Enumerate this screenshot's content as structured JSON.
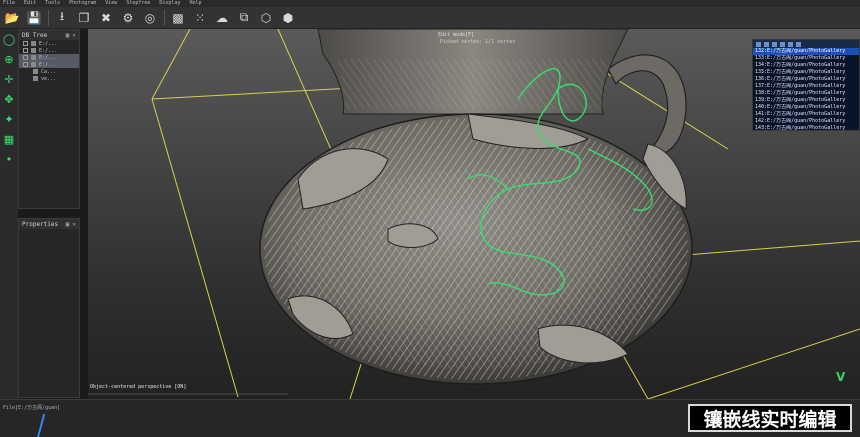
{
  "menu": [
    "File",
    "Edit",
    "Tools",
    "Photogram",
    "View",
    "Stepfree",
    "Display",
    "Help"
  ],
  "toolbar_icons": [
    "folder-open-icon",
    "save-icon",
    "import-icon",
    "clone-icon",
    "delete-icon",
    "settings-icon",
    "globe-icon",
    "mesh-icon",
    "points-icon",
    "cloud-icon",
    "merge-icon",
    "segment-icon",
    "sample-icon"
  ],
  "left_tools": [
    "select-icon",
    "zoom-icon",
    "translate-icon",
    "pivot-icon",
    "lasso-icon",
    "grid-icon",
    "point-icon"
  ],
  "dbtree": {
    "title": "DB Tree",
    "rows": [
      "E:/...",
      "E:/...",
      "E:/...",
      "E:/...",
      "Ca...",
      "ve..."
    ]
  },
  "properties": {
    "title": "Properties"
  },
  "viewport": {
    "overlay_text": "Object-centered perspective [ON]",
    "label_top": "Edit mode[F]",
    "label_top2": "Picked vertex: 1/1 vertex"
  },
  "console": {
    "rows": [
      "132:E:/万古阁/guan/PhotoGallery",
      "133:E:/万古阁/guan/PhotoGallery",
      "134:E:/万古阁/guan/PhotoGallery",
      "135:E:/万古阁/guan/PhotoGallery",
      "136:E:/万古阁/guan/PhotoGallery",
      "137:E:/万古阁/guan/PhotoGallery",
      "138:E:/万古阁/guan/PhotoGallery",
      "139:E:/万古阁/guan/PhotoGallery",
      "140:E:/万古阁/guan/PhotoGallery",
      "141:E:/万古阁/guan/PhotoGallery",
      "142:E:/万古阁/guan/PhotoGallery",
      "143:E:/万古阁/guan/PhotoGallery"
    ],
    "selected_index": 0
  },
  "status": {
    "path": "File[E:/万古阁/guan]"
  },
  "caption": "镶嵌线实时编辑",
  "watermark": "V",
  "colors": {
    "accent_green": "#35e06b",
    "bbox_yellow": "#d8d04a",
    "console_bg": "#0a1428",
    "console_sel": "#1d4fb8"
  }
}
